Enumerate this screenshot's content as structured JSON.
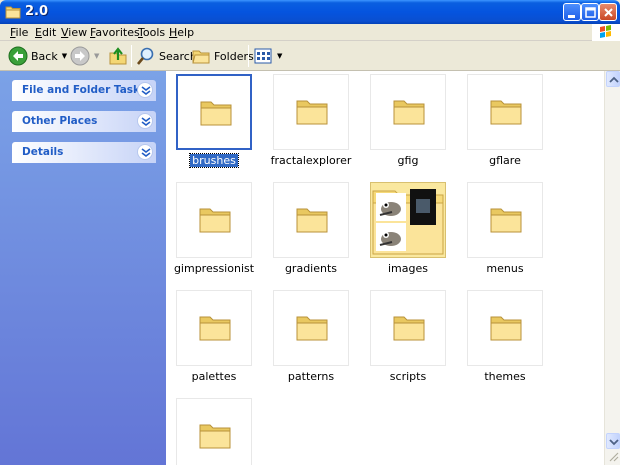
{
  "window": {
    "title": "2.0",
    "icon": "folder-icon"
  },
  "menu": [
    {
      "label": "File",
      "accel": "F",
      "rest": "ile"
    },
    {
      "label": "Edit",
      "accel": "E",
      "rest": "dit"
    },
    {
      "label": "View",
      "accel": "V",
      "rest": "iew"
    },
    {
      "label": "Favorites",
      "accel": "F",
      "rest": "avorites"
    },
    {
      "label": "Tools",
      "accel": "T",
      "rest": "ools"
    },
    {
      "label": "Help",
      "accel": "H",
      "rest": "elp"
    }
  ],
  "toolbar": {
    "back_label": "Back",
    "search_label": "Search",
    "folders_label": "Folders"
  },
  "taskpane": {
    "sections": [
      "File and Folder Tasks",
      "Other Places",
      "Details"
    ]
  },
  "folders": [
    "brushes",
    "fractalexplorer",
    "gfig",
    "gflare",
    "gimpressionist",
    "gradients",
    "images",
    "menus",
    "palettes",
    "patterns",
    "scripts",
    "themes",
    ""
  ],
  "selected_folder": "brushes",
  "colors": {
    "title_bar": "#0554df",
    "task_pane": "#6375d6",
    "selection": "#316ac5"
  }
}
